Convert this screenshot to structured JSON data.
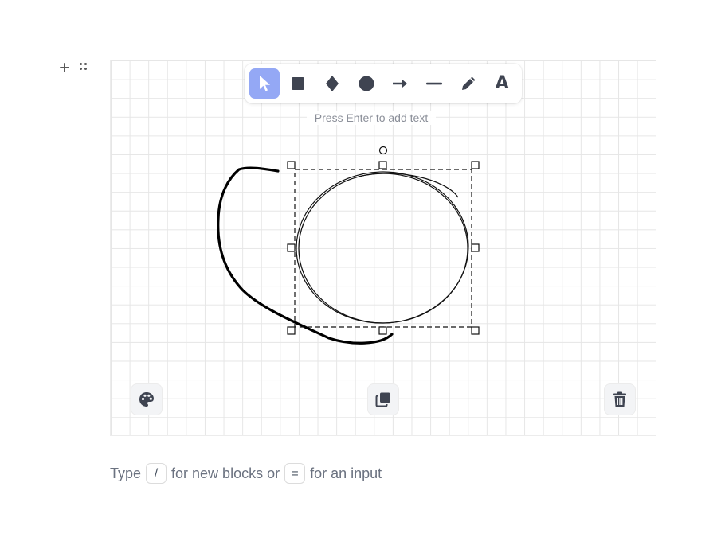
{
  "toolbar": {
    "tools": [
      {
        "name": "select",
        "icon": "cursor-icon",
        "active": true
      },
      {
        "name": "rectangle",
        "icon": "square-icon",
        "active": false
      },
      {
        "name": "diamond",
        "icon": "diamond-icon",
        "active": false
      },
      {
        "name": "ellipse",
        "icon": "circle-icon",
        "active": false
      },
      {
        "name": "arrow",
        "icon": "arrow-right-icon",
        "active": false
      },
      {
        "name": "line",
        "icon": "line-icon",
        "active": false
      },
      {
        "name": "draw",
        "icon": "pencil-icon",
        "active": false
      },
      {
        "name": "text",
        "icon": "text-icon",
        "active": false
      }
    ],
    "text_tool_glyph": "A"
  },
  "hint": "Press Enter to add text",
  "actions": {
    "style_icon": "palette-icon",
    "duplicate_icon": "duplicate-icon",
    "delete_icon": "trash-icon"
  },
  "placeholder": {
    "prefix": "Type",
    "slash_key": "/",
    "middle": "for new blocks or",
    "equals_key": "=",
    "suffix": "for an input"
  },
  "colors": {
    "accent": "#94a8f5",
    "icon": "#3f4451",
    "grid": "#e6e6e6"
  }
}
